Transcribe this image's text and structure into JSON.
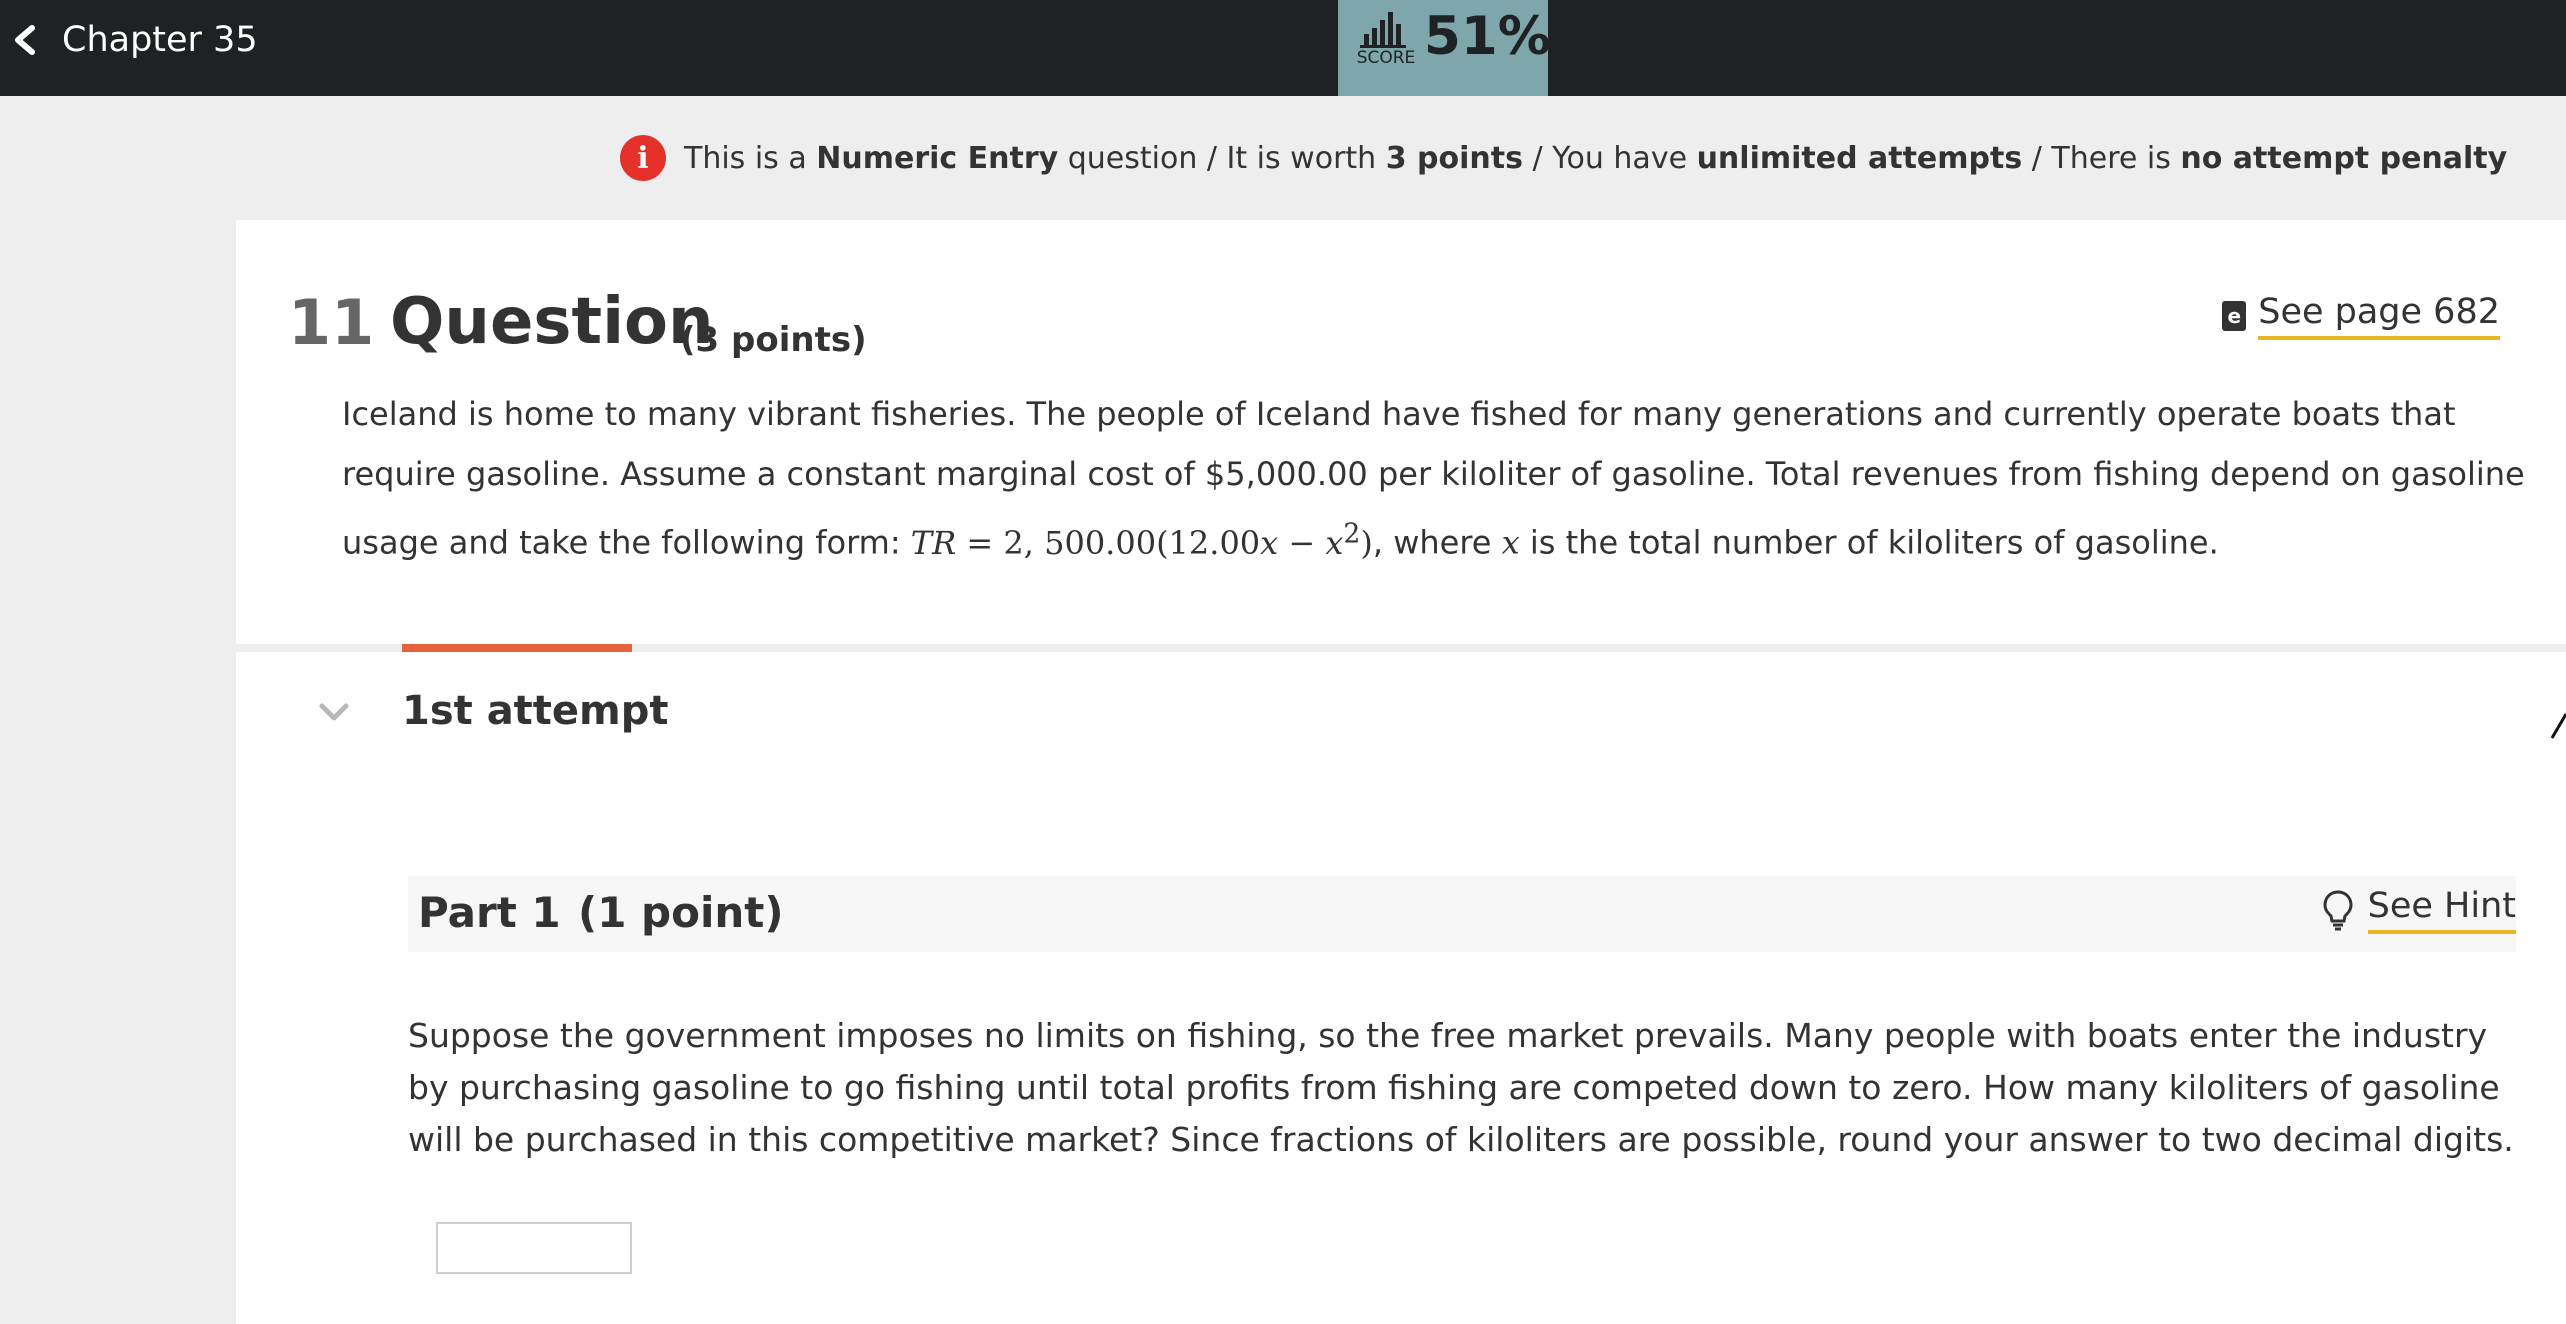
{
  "topbar": {
    "back_label": "Chapter 35",
    "score_caption": "SCORE",
    "score_value": "51%"
  },
  "banner": {
    "prefix": "This is a",
    "question_type": "Numeric Entry",
    "mid1": "question / It is worth",
    "points": "3 points",
    "mid2": "/ You have",
    "attempts": "unlimited attempts",
    "mid3": "/ There is",
    "penalty": "no attempt penalty"
  },
  "question": {
    "number": "11",
    "title": "Question",
    "points": "(3 points)",
    "see_page_icon": "e",
    "see_page_label": "See page 682",
    "text_1": "Iceland is home to many vibrant fisheries. The people of Iceland have fished for many generations and currently operate boats that require gasoline. Assume a constant marginal cost of $5,000.00 per kiloliter of gasoline. Total revenues from fishing depend on gasoline usage and take the following form:",
    "formula_lhs": "TR",
    "formula_eq": " = 2, 500.00(12.00",
    "formula_x1": "x",
    "formula_minus": " − ",
    "formula_x2": "x",
    "formula_exp": "2",
    "formula_close": ")",
    "text_2": ", where",
    "text_var": "x",
    "text_3": "is the total number of kiloliters of gasoline."
  },
  "attempt": {
    "label": "1st attempt"
  },
  "part": {
    "label": "Part 1",
    "points": "(1 point)",
    "see_hint_label": "See Hint",
    "text": "Suppose the government imposes no limits on fishing, so the free market prevails. Many people with boats enter the industry by purchasing gasoline to go fishing until total profits from fishing are competed down to zero. How many kiloliters of gasoline will be purchased in this competitive market? Since fractions of kiloliters are possible, round your answer to two decimal digits.",
    "answer_value": ""
  }
}
